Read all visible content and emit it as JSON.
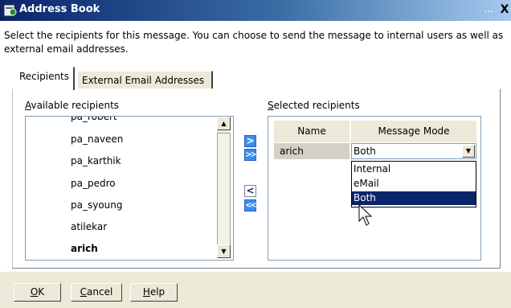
{
  "window": {
    "title": "Address Book",
    "dots": "...",
    "close": "X",
    "icon": "address-book-icon"
  },
  "description": "Select the recipients for this message. You can choose to send the message to internal users as well as external email addresses.",
  "tabs": {
    "recipients": "Recipients",
    "external": "External Email Addresses"
  },
  "available": {
    "label_key": "A",
    "label_rest": "vailable recipients",
    "items": [
      "pa_robert",
      "pa_naveen",
      "pa_karthik",
      "pa_pedro",
      "pa_syoung",
      "atilekar",
      "arich"
    ],
    "selected_item": "arich"
  },
  "selected": {
    "label_key": "S",
    "label_rest": "elected recipients",
    "columns": [
      "Name",
      "Message Mode"
    ],
    "rows": [
      {
        "name": "arich",
        "mode": "Both"
      }
    ]
  },
  "mode_dropdown": {
    "options": [
      "Internal",
      "eMail",
      "Both"
    ],
    "highlighted": "Both"
  },
  "arrows": {
    "add": ">",
    "add_all": ">>",
    "remove": "<",
    "remove_all": "<<"
  },
  "buttons": {
    "ok_key": "O",
    "ok_rest": "K",
    "cancel_key": "C",
    "cancel_rest": "ancel",
    "help_key": "H",
    "help_rest": "elp"
  },
  "colors": {
    "title_start": "#0a246a",
    "title_end": "#a6caf0",
    "arrow_blue": "#3a8ef0",
    "selection": "#0a246a"
  }
}
